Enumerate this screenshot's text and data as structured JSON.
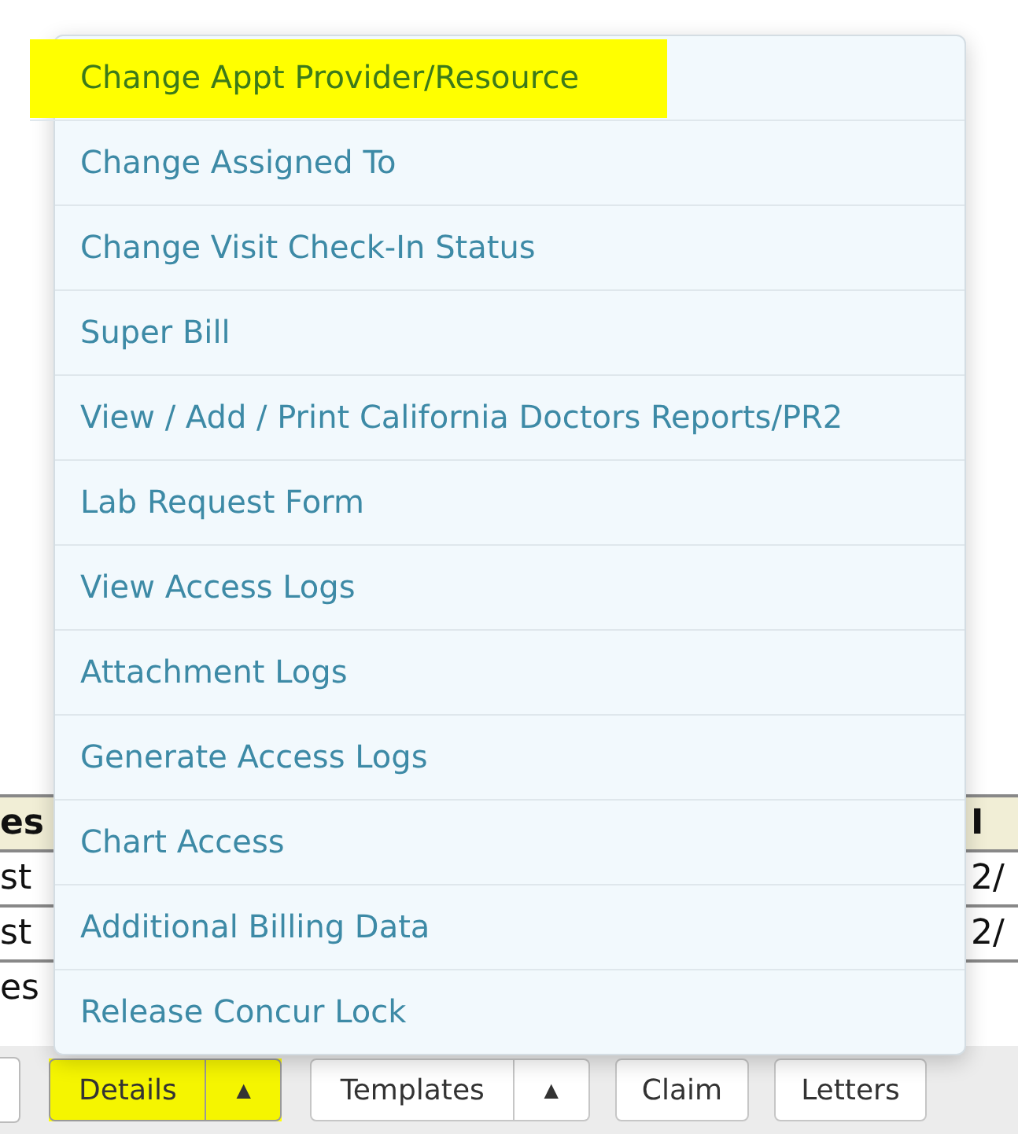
{
  "table": {
    "columns": [
      {
        "label": "es"
      },
      {
        "label": "I"
      }
    ],
    "rows": [
      [
        "st",
        "2/"
      ],
      [
        "st",
        "2/"
      ],
      [
        "es",
        ""
      ]
    ]
  },
  "menu": {
    "items": [
      {
        "label": "Change Appt Provider/Resource",
        "highlighted": true
      },
      {
        "label": "Change Assigned To",
        "highlighted": false
      },
      {
        "label": "Change Visit Check-In Status",
        "highlighted": false
      },
      {
        "label": "Super Bill",
        "highlighted": false
      },
      {
        "label": "View / Add / Print California Doctors Reports/PR2",
        "highlighted": false
      },
      {
        "label": "Lab Request Form",
        "highlighted": false
      },
      {
        "label": "View Access Logs",
        "highlighted": false
      },
      {
        "label": "Attachment Logs",
        "highlighted": false
      },
      {
        "label": "Generate Access Logs",
        "highlighted": false
      },
      {
        "label": "Chart Access",
        "highlighted": false
      },
      {
        "label": "Additional Billing Data",
        "highlighted": false
      },
      {
        "label": "Release Concur Lock",
        "highlighted": false
      }
    ]
  },
  "toolbar": [
    {
      "kind": "stub",
      "highlighted": false
    },
    {
      "kind": "split",
      "label": "Details",
      "caret": "▲",
      "highlighted": true
    },
    {
      "kind": "split",
      "label": "Templates",
      "caret": "▲",
      "highlighted": false
    },
    {
      "kind": "button",
      "label": "Claim",
      "highlighted": false
    },
    {
      "kind": "button",
      "label": "Letters",
      "highlighted": false
    }
  ]
}
